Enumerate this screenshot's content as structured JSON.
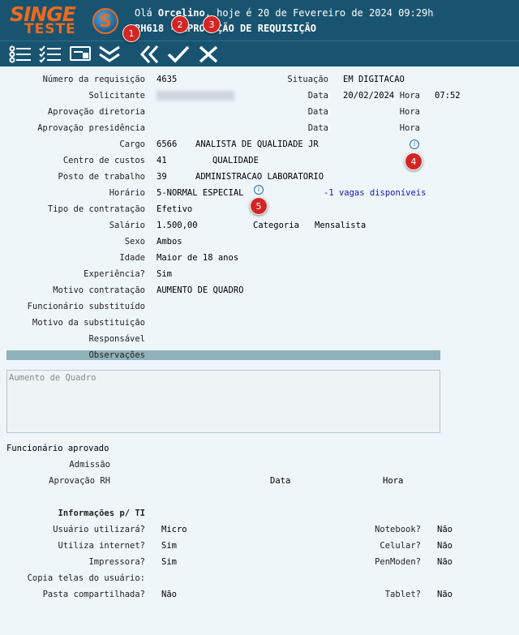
{
  "brand": {
    "name_top": "SINGE",
    "name_bottom": "TESTE",
    "mark": "S"
  },
  "header": {
    "greeting_prefix": "Olá ",
    "user": "Orcelino",
    "greeting_suffix": ", hoje é 20 de Fevereiro de 2024 09:29h",
    "title": "RH618 - APROVAÇÃO DE REQUISIÇÃO"
  },
  "toolbar": {
    "icons": [
      "list-icon",
      "checklist-icon",
      "card-icon",
      "double-chevron-down-icon",
      "back-icon",
      "approve-check-icon",
      "reject-x-icon"
    ]
  },
  "markers": [
    "1",
    "2",
    "3",
    "4",
    "5"
  ],
  "form": {
    "numero_label": "Número da requisição",
    "numero": "4635",
    "situacao_label": "Situação",
    "situacao": "EM DIGITACAO",
    "solicitante_label": "Solicitante",
    "data_label": "Data",
    "data": "20/02/2024",
    "hora_label": "Hora",
    "hora": "07:52",
    "aprov_dir_label": "Aprovação diretoria",
    "aprov_pres_label": "Aprovação presidência",
    "cargo_label": "Cargo",
    "cargo_cod": "6566",
    "cargo_nome": "ANALISTA DE QUALIDADE JR",
    "centro_label": "Centro de custos",
    "centro_cod": "41",
    "centro_nome": "QUALIDADE",
    "posto_label": "Posto de trabalho",
    "posto_cod": "39",
    "posto_nome": "ADMINISTRACAO LABORATORIO",
    "horario_label": "Horário",
    "horario": "5-NORMAL ESPECIAL",
    "vagas": "-1 vagas disponíveis",
    "tipo_label": "Tipo de contratação",
    "tipo": "Efetivo",
    "salario_label": "Salário",
    "salario": "1.500,00",
    "categoria_label": "Categoria",
    "categoria": "Mensalista",
    "sexo_label": "Sexo",
    "sexo": "Ambos",
    "idade_label": "Idade",
    "idade": "Maior de 18 anos",
    "experiencia_label": "Experiência?",
    "experiencia": "Sim",
    "motivo_label": "Motivo contratação",
    "motivo": "AUMENTO DE QUADRO",
    "func_subst_label": "Funcionário substituído",
    "motivo_subst_label": "Motivo da substituição",
    "responsavel_label": "Responsável",
    "observacoes_label": "Observações",
    "observacoes": "Aumento de Quadro"
  },
  "approval": {
    "func_aprovado_label": "Funcionário aprovado",
    "admissao_label": "Admissão",
    "aprov_rh_label": "Aprovação RH",
    "data_label": "Data",
    "hora_label": "Hora"
  },
  "ti": {
    "title": "Informações p/ TI",
    "usuario_label": "Usuário utilizará?",
    "usuario": "Micro",
    "internet_label": "Utiliza internet?",
    "internet": "Sim",
    "impressora_label": "Impressora?",
    "impressora": "Sim",
    "copia_label": "Copia telas do usuário:",
    "pasta_label": "Pasta compartilhada?",
    "pasta": "Não",
    "notebook_label": "Notebook?",
    "notebook": "Não",
    "celular_label": "Celular?",
    "celular": "Não",
    "penmoden_label": "PenModen?",
    "penmoden": "Não",
    "tablet_label": "Tablet?",
    "tablet": "Não"
  },
  "colors": {
    "header_bg": "#185470",
    "brand_orange": "#ef6a1c",
    "marker_red": "#d42525",
    "obs_bar": "#8fb1ba",
    "link_blue": "#1414b4"
  }
}
